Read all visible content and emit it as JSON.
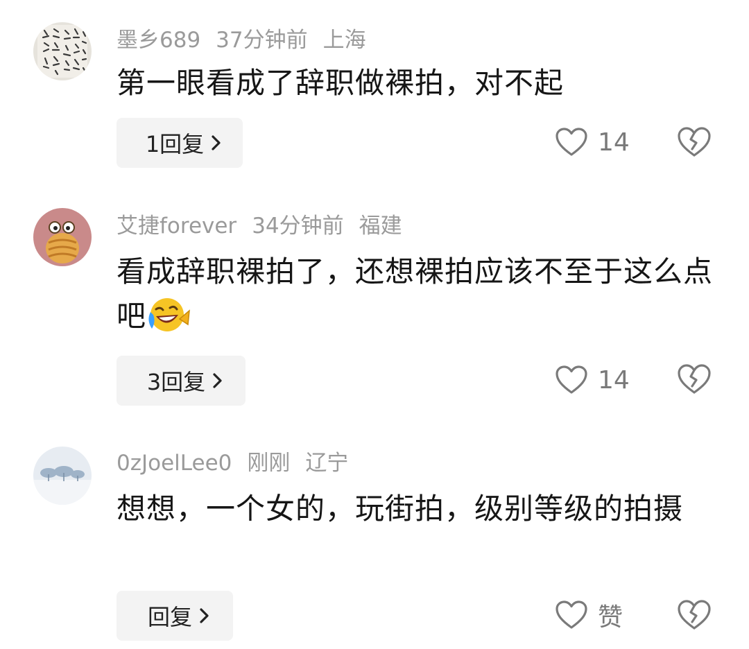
{
  "comments": [
    {
      "username": "墨乡689",
      "time": "37分钟前",
      "location": "上海",
      "text": "第一眼看成了辞职做裸拍，对不起",
      "reply_label": "1回复",
      "like_count": "14",
      "avatar_icon": "calligraphy-avatar",
      "dislike_icon": "broken-heart-icon"
    },
    {
      "username": "艾捷forever",
      "time": "34分钟前",
      "location": "福建",
      "text": "看成辞职裸拍了，还想裸拍应该不至于这么点吧",
      "emoji": "laughing-crying-emoji",
      "reply_label": "3回复",
      "like_count": "14",
      "avatar_icon": "cartoon-avatar",
      "dislike_icon": "broken-heart-icon"
    },
    {
      "username": "0zJoelLee0",
      "time": "刚刚",
      "location": "辽宁",
      "text": "想想，一个女的，玩街拍，级别等级的拍摄",
      "reply_label": "回复",
      "like_count": "赞",
      "avatar_icon": "snow-trees-avatar",
      "dislike_icon": "broken-heart-icon"
    }
  ],
  "colors": {
    "meta_text": "#9a9a9a",
    "body_text": "#161616",
    "reply_bg": "#f3f3f3",
    "icon_stroke": "#7a7a7a"
  }
}
